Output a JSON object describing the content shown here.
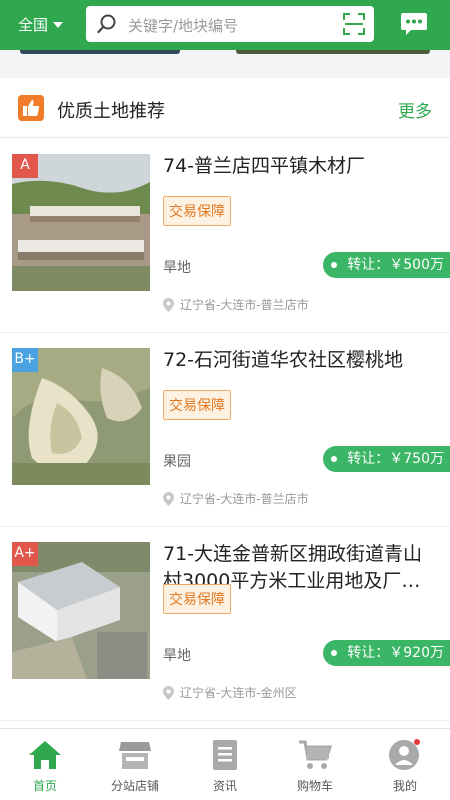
{
  "header": {
    "region": "全国",
    "search_placeholder": "关键字/地块编号",
    "accent": "#2fa84f"
  },
  "section": {
    "title": "优质土地推荐",
    "more": "更多"
  },
  "listings": [
    {
      "grade": "A",
      "title": "74-普兰店四平镇木材厂",
      "badge": "交易保障",
      "category": "旱地",
      "price": "转让：￥500万",
      "location": "辽宁省-大连市-普兰店市"
    },
    {
      "grade": "B+",
      "title": "72-石河街道华农社区樱桃地",
      "badge": "交易保障",
      "category": "果园",
      "price": "转让：￥750万",
      "location": "辽宁省-大连市-普兰店市"
    },
    {
      "grade": "A+",
      "title": "71-大连金普新区拥政街道青山村3000平方米工业用地及厂…",
      "badge": "交易保障",
      "category": "旱地",
      "price": "转让：￥920万",
      "location": "辽宁省-大连市-金州区"
    }
  ],
  "tabbar": [
    {
      "label": "首页",
      "icon": "home-icon",
      "active": true
    },
    {
      "label": "分站店铺",
      "icon": "store-icon",
      "active": false
    },
    {
      "label": "资讯",
      "icon": "news-icon",
      "active": false
    },
    {
      "label": "购物车",
      "icon": "cart-icon",
      "active": false
    },
    {
      "label": "我的",
      "icon": "profile-icon",
      "active": false
    }
  ]
}
